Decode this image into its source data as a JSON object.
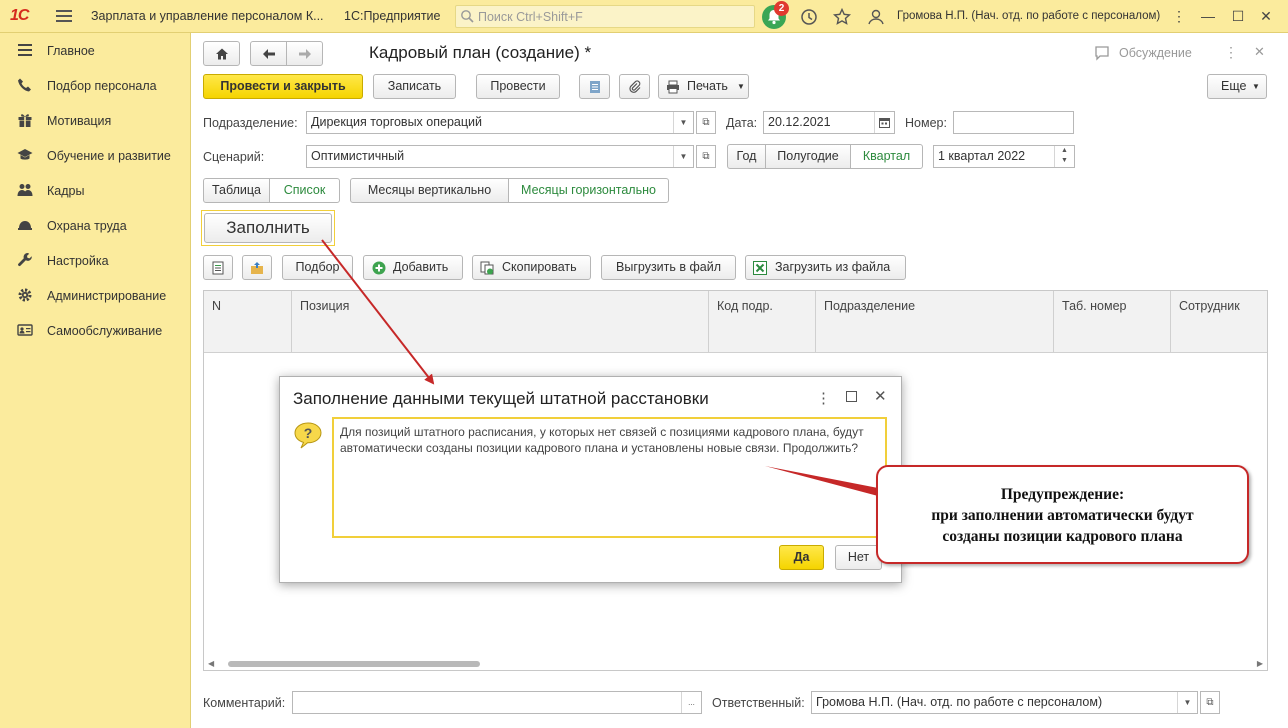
{
  "topbar": {
    "logo": "1С",
    "app_title": "Зарплата и управление персоналом К...",
    "platform": "1С:Предприятие",
    "search_placeholder": "Поиск Ctrl+Shift+F",
    "notifications_count": "2",
    "user": "Громова Н.П. (Нач. отд. по работе с персоналом)"
  },
  "sidebar": {
    "items": [
      {
        "label": "Главное",
        "icon": "menu-lines-icon"
      },
      {
        "label": "Подбор персонала",
        "icon": "phone-icon"
      },
      {
        "label": "Мотивация",
        "icon": "gift-icon"
      },
      {
        "label": "Обучение и развитие",
        "icon": "graduation-cap-icon"
      },
      {
        "label": "Кадры",
        "icon": "people-icon"
      },
      {
        "label": "Охрана труда",
        "icon": "helmet-icon"
      },
      {
        "label": "Настройка",
        "icon": "wrench-icon"
      },
      {
        "label": "Администрирование",
        "icon": "gear-icon"
      },
      {
        "label": "Самообслуживание",
        "icon": "id-card-icon"
      }
    ]
  },
  "form": {
    "title": "Кадровый план (создание) *",
    "discussion": "Обсуждение",
    "buttons": {
      "post_close": "Провести и закрыть",
      "save": "Записать",
      "post": "Провести",
      "print": "Печать",
      "more": "Еще",
      "fill": "Заполнить"
    },
    "department_label": "Подразделение:",
    "department_value": "Дирекция торговых операций",
    "date_label": "Дата:",
    "date_value": "20.12.2021",
    "number_label": "Номер:",
    "number_value": "",
    "scenario_label": "Сценарий:",
    "scenario_value": "Оптимистичный",
    "period_options": [
      "Год",
      "Полугодие",
      "Квартал"
    ],
    "period_selected": "Квартал",
    "period_value": "1 квартал 2022",
    "view_options": [
      "Таблица",
      "Список"
    ],
    "view_selected": "Список",
    "months_options": [
      "Месяцы вертикально",
      "Месяцы горизонтально"
    ],
    "months_selected": "Месяцы горизонтально",
    "table_toolbar": {
      "pick": "Подбор",
      "add": "Добавить",
      "copy": "Скопировать",
      "export": "Выгрузить в файл",
      "import": "Загрузить из файла"
    },
    "columns": [
      "N",
      "Позиция",
      "Код подр.",
      "Подразделение",
      "Таб. номер",
      "Сотрудник"
    ],
    "comment_label": "Комментарий:",
    "comment_value": "",
    "responsible_label": "Ответственный:",
    "responsible_value": "Громова Н.П. (Нач. отд. по работе с персоналом)"
  },
  "dialog": {
    "title": "Заполнение данными текущей штатной расстановки",
    "message": "Для позиций штатного расписания, у которых нет связей с позициями кадрового плана, будут автоматически созданы позиции кадрового плана и установлены новые связи. Продолжить?",
    "yes": "Да",
    "no": "Нет"
  },
  "callout": {
    "line1": "Предупреждение:",
    "line2": "при заполнении автоматически  будут",
    "line3": "созданы позиции кадрового плана"
  },
  "colors": {
    "accent_yellow": "#fbeb9d",
    "button_yellow": "#f5d400",
    "active_green": "#2c8a3d",
    "annotation_red": "#c62828"
  }
}
